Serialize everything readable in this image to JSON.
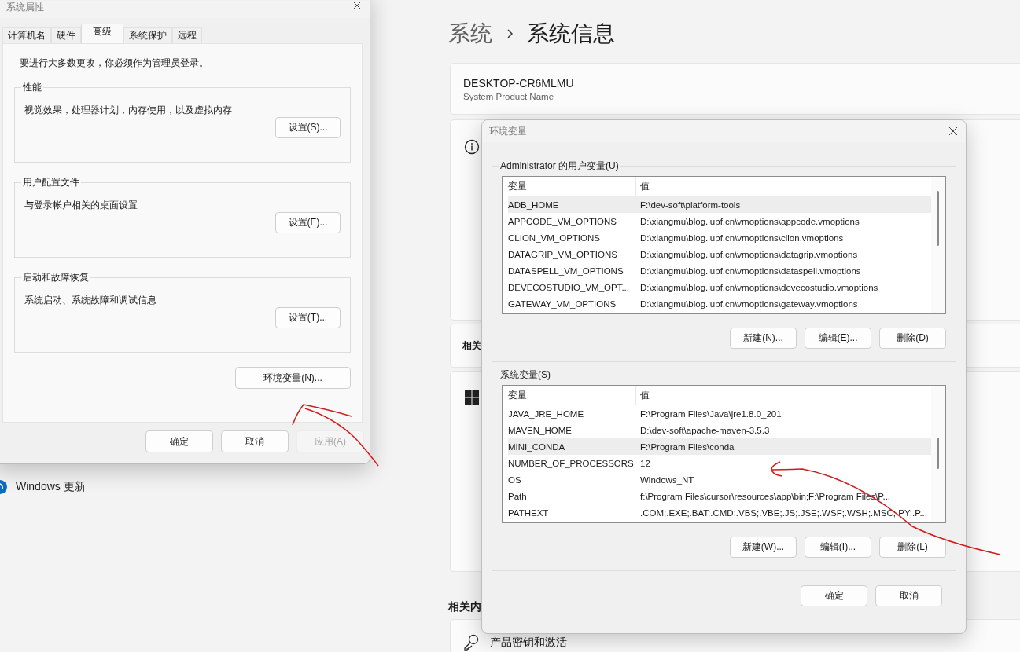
{
  "settings_page": {
    "breadcrumb": [
      "系统",
      "系统信息"
    ],
    "device": {
      "name": "DESKTOP-CR6MLMU",
      "model": "System Product Name"
    },
    "section_label": "相关",
    "related_heading": "相关内",
    "product_key": "产品密钥和激活"
  },
  "sidebar": {
    "windows_update": "Windows 更新"
  },
  "system_properties": {
    "title": "系统属性",
    "tabs": [
      {
        "label": "计算机名",
        "selected": false
      },
      {
        "label": "硬件",
        "selected": false
      },
      {
        "label": "高级",
        "selected": true
      },
      {
        "label": "系统保护",
        "selected": false
      },
      {
        "label": "远程",
        "selected": false
      }
    ],
    "notice": "要进行大多数更改，你必须作为管理员登录。",
    "groups": [
      {
        "title": "性能",
        "description": "视觉效果，处理器计划，内存使用，以及虚拟内存",
        "button": "设置(S)..."
      },
      {
        "title": "用户配置文件",
        "description": "与登录帐户相关的桌面设置",
        "button": "设置(E)..."
      },
      {
        "title": "启动和故障恢复",
        "description": "系统启动、系统故障和调试信息",
        "button": "设置(T)..."
      }
    ],
    "env_button": "环境变量(N)...",
    "buttons": [
      {
        "label": "确定",
        "disabled": false
      },
      {
        "label": "取消",
        "disabled": false
      },
      {
        "label": "应用(A)",
        "disabled": true
      }
    ]
  },
  "environment_variables": {
    "title": "环境变量",
    "sections": [
      {
        "legend": "Administrator 的用户变量(U)",
        "columns": [
          "变量",
          "值"
        ],
        "rows": [
          {
            "name": "ADB_HOME",
            "value": "F:\\dev-soft\\platform-tools",
            "selected": true
          },
          {
            "name": "APPCODE_VM_OPTIONS",
            "value": "D:\\xiangmu\\blog.lupf.cn\\vmoptions\\appcode.vmoptions",
            "selected": false
          },
          {
            "name": "CLION_VM_OPTIONS",
            "value": "D:\\xiangmu\\blog.lupf.cn\\vmoptions\\clion.vmoptions",
            "selected": false
          },
          {
            "name": "DATAGRIP_VM_OPTIONS",
            "value": "D:\\xiangmu\\blog.lupf.cn\\vmoptions\\datagrip.vmoptions",
            "selected": false
          },
          {
            "name": "DATASPELL_VM_OPTIONS",
            "value": "D:\\xiangmu\\blog.lupf.cn\\vmoptions\\dataspell.vmoptions",
            "selected": false
          },
          {
            "name": "DEVECOSTUDIO_VM_OPT...",
            "value": "D:\\xiangmu\\blog.lupf.cn\\vmoptions\\devecostudio.vmoptions",
            "selected": false
          },
          {
            "name": "GATEWAY_VM_OPTIONS",
            "value": "D:\\xiangmu\\blog.lupf.cn\\vmoptions\\gateway.vmoptions",
            "selected": false
          }
        ],
        "buttons": [
          "新建(N)...",
          "编辑(E)...",
          "删除(D)"
        ]
      },
      {
        "legend": "系统变量(S)",
        "columns": [
          "变量",
          "值"
        ],
        "rows": [
          {
            "name": "JAVA_JRE_HOME",
            "value": "F:\\Program Files\\Java\\jre1.8.0_201",
            "selected": false
          },
          {
            "name": "MAVEN_HOME",
            "value": "D:\\dev-soft\\apache-maven-3.5.3",
            "selected": false
          },
          {
            "name": "MINI_CONDA",
            "value": "F:\\Program Files\\conda",
            "selected": true
          },
          {
            "name": "NUMBER_OF_PROCESSORS",
            "value": "12",
            "selected": false
          },
          {
            "name": "OS",
            "value": "Windows_NT",
            "selected": false
          },
          {
            "name": "Path",
            "value": "f:\\Program Files\\cursor\\resources\\app\\bin;F:\\Program Files\\P...",
            "selected": false
          },
          {
            "name": "PATHEXT",
            "value": ".COM;.EXE;.BAT;.CMD;.VBS;.VBE;.JS;.JSE;.WSF;.WSH;.MSC;.PY;.P...",
            "selected": false
          }
        ],
        "buttons": [
          "新建(W)...",
          "编辑(I)...",
          "删除(L)"
        ]
      }
    ],
    "buttons": [
      "确定",
      "取消"
    ]
  }
}
